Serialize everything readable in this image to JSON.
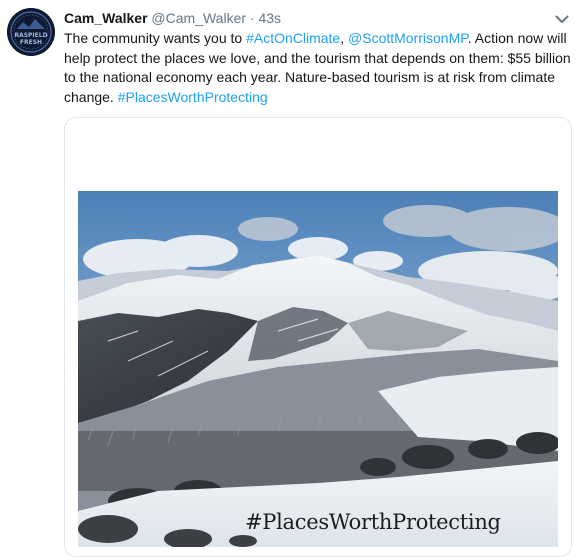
{
  "tweet": {
    "display_name": "Cam_Walker",
    "handle": "@Cam_Walker",
    "separator": "·",
    "time": "43s",
    "text": [
      {
        "type": "text",
        "value": "The community wants you to "
      },
      {
        "type": "link",
        "value": "#ActOnClimate"
      },
      {
        "type": "text",
        "value": ", "
      },
      {
        "type": "link",
        "value": "@ScottMorrisonMP"
      },
      {
        "type": "text",
        "value": ". Action now will help protect the places we love, and the tourism that depends on them: $55 billion to the national economy each year. Nature-based tourism is at risk from climate change. "
      },
      {
        "type": "link",
        "value": "#PlacesWorthProtecting"
      }
    ],
    "avatar_text": [
      "RASPIELD",
      "FRESH"
    ],
    "card_image": {
      "icon": "snowy-mountain-photo",
      "caption": "#PlacesWorthProtecting"
    }
  },
  "colors": {
    "link": "#1da1f2",
    "name": "#14171a",
    "secondary": "#657786",
    "card_border": "#e1e8ed"
  }
}
